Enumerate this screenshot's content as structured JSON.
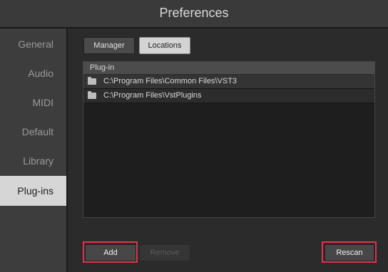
{
  "window": {
    "title": "Preferences"
  },
  "sidebar": {
    "items": [
      {
        "label": "General",
        "active": false
      },
      {
        "label": "Audio",
        "active": false
      },
      {
        "label": "MIDI",
        "active": false
      },
      {
        "label": "Default",
        "active": false
      },
      {
        "label": "Library",
        "active": false
      },
      {
        "label": "Plug-ins",
        "active": true
      }
    ]
  },
  "tabs": {
    "manager_label": "Manager",
    "locations_label": "Locations",
    "selected": "Locations"
  },
  "list": {
    "column_header": "Plug-in",
    "rows": [
      {
        "icon": "folder-icon",
        "path": "C:\\Program Files\\Common Files\\VST3"
      },
      {
        "icon": "folder-icon",
        "path": "C:\\Program Files\\VstPlugins"
      }
    ]
  },
  "buttons": {
    "add_label": "Add",
    "remove_label": "Remove",
    "remove_disabled": true,
    "rescan_label": "Rescan"
  },
  "colors": {
    "highlight": "#e0344a",
    "active_item_bg": "#d6d6d6"
  }
}
